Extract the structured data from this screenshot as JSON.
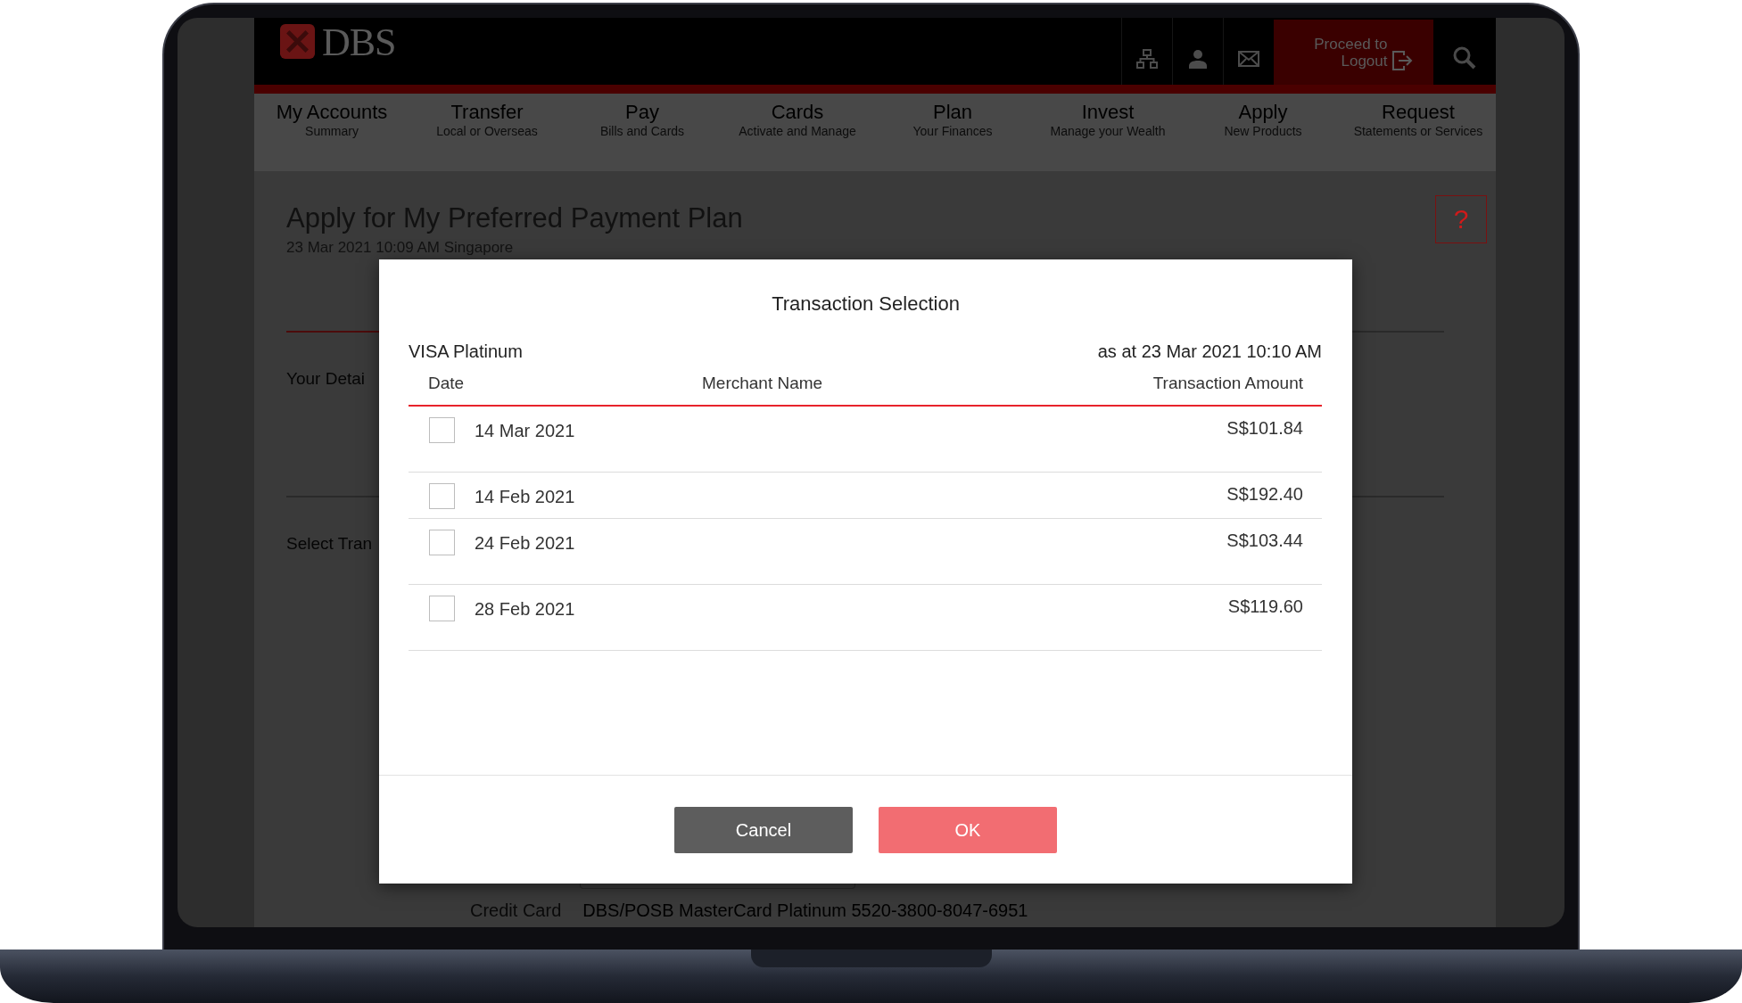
{
  "header": {
    "logo": "DBS",
    "logout": "Proceed to Logout"
  },
  "nav": [
    {
      "title": "My Accounts",
      "subtitle": "Summary"
    },
    {
      "title": "Transfer",
      "subtitle": "Local or Overseas"
    },
    {
      "title": "Pay",
      "subtitle": "Bills and Cards"
    },
    {
      "title": "Cards",
      "subtitle": "Activate and Manage"
    },
    {
      "title": "Plan",
      "subtitle": "Your Finances"
    },
    {
      "title": "Invest",
      "subtitle": "Manage your Wealth"
    },
    {
      "title": "Apply",
      "subtitle": "New Products"
    },
    {
      "title": "Request",
      "subtitle": "Statements or Services"
    }
  ],
  "page": {
    "title": "Apply for My Preferred Payment Plan",
    "timestamp": "23 Mar 2021 10:09 AM Singapore",
    "help": "?",
    "sections": [
      "Your Detai",
      "Select Tran"
    ],
    "field": {
      "label": "Credit Card",
      "value": "DBS/POSB MasterCard Platinum 5520-3800-8047-6951"
    }
  },
  "modal": {
    "title": "Transaction Selection",
    "card": "VISA Platinum",
    "as_at": "as at 23 Mar 2021 10:10 AM",
    "columns": [
      "Date",
      "Merchant Name",
      "Transaction Amount"
    ],
    "rows": [
      {
        "date": "14 Mar 2021",
        "amount": "S$101.84",
        "checked": false
      },
      {
        "date": "14 Feb 2021",
        "amount": "S$192.40",
        "checked": false
      },
      {
        "date": "24 Feb 2021",
        "amount": "S$103.44",
        "checked": false
      },
      {
        "date": "28 Feb 2021",
        "amount": "S$119.60",
        "checked": false
      }
    ],
    "buttons": [
      {
        "label": "Cancel",
        "kind": "secondary"
      },
      {
        "label": "OK",
        "kind": "primary"
      }
    ]
  }
}
